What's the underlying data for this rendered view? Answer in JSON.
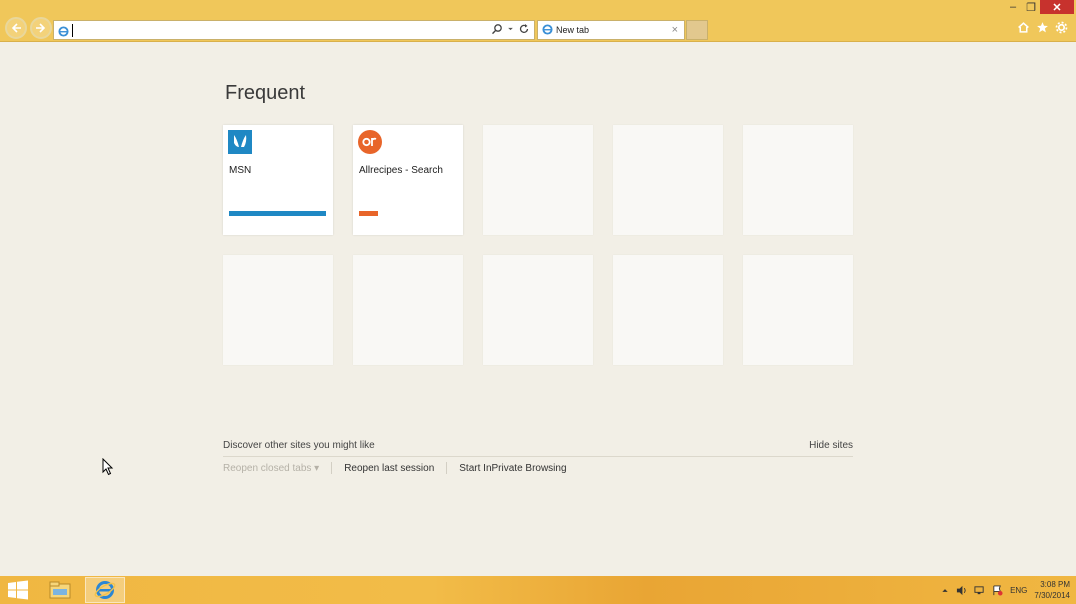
{
  "browser": {
    "address_value": "",
    "tab_title": "New tab",
    "tab_close": "×",
    "window_controls": {
      "minimize": "–",
      "maximize": "❐",
      "close": "✕"
    },
    "colors": {
      "chrome": "#f0c75a",
      "close": "#c7322d"
    }
  },
  "page": {
    "heading": "Frequent",
    "tiles": [
      {
        "title": "MSN",
        "icon": "msn-butterfly-icon",
        "accent": "#1f88c4",
        "bar_fraction": 0.9
      },
      {
        "title": "Allrecipes - Search",
        "icon": "allrecipes-icon",
        "accent": "#e8652a",
        "bar_fraction": 0.18
      },
      {
        "title": ""
      },
      {
        "title": ""
      },
      {
        "title": ""
      },
      {
        "title": ""
      },
      {
        "title": ""
      },
      {
        "title": ""
      },
      {
        "title": ""
      },
      {
        "title": ""
      }
    ],
    "discover_text": "Discover other sites you might like",
    "hide_sites": "Hide sites",
    "reopen_closed_tabs": "Reopen closed tabs ▾",
    "reopen_last_session": "Reopen last session",
    "start_inprivate": "Start InPrivate Browsing"
  },
  "taskbar": {
    "apps": [
      "start-icon",
      "file-explorer-icon",
      "internet-explorer-icon"
    ],
    "language": "ENG",
    "time": "3:08 PM",
    "date": "7/30/2014"
  }
}
